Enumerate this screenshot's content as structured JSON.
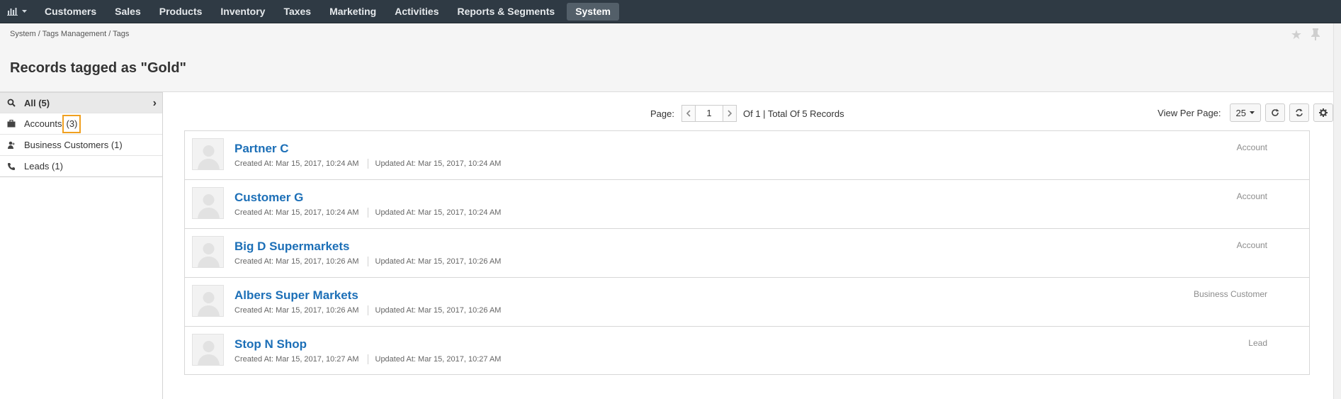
{
  "nav": {
    "items": [
      "Customers",
      "Sales",
      "Products",
      "Inventory",
      "Taxes",
      "Marketing",
      "Activities",
      "Reports & Segments"
    ],
    "active": "System",
    "logo_icon": "bar-chart-icon",
    "accent": "#2f3a44"
  },
  "header": {
    "breadcrumb": "System / Tags Management / Tags",
    "title": "Records tagged as \"Gold\"",
    "icons": [
      "star-icon",
      "pin-icon"
    ]
  },
  "sidebar": {
    "items": [
      {
        "label": "All (5)",
        "icon": "search-icon"
      },
      {
        "label": "Accounts",
        "count": "(3)",
        "icon": "briefcase-icon"
      },
      {
        "label": "Business Customers (1)",
        "icon": "user-group-icon"
      },
      {
        "label": "Leads (1)",
        "icon": "phone-icon"
      }
    ]
  },
  "pager": {
    "label": "Page:",
    "current": "1",
    "total_text": "Of 1 | Total Of 5 Records",
    "view_per_page_label": "View Per Page:",
    "per_page": "25"
  },
  "records": [
    {
      "title": "Partner C",
      "created": "Created At: Mar 15, 2017, 10:24 AM",
      "updated": "Updated At: Mar 15, 2017, 10:24 AM",
      "type": "Account"
    },
    {
      "title": "Customer G",
      "created": "Created At: Mar 15, 2017, 10:24 AM",
      "updated": "Updated At: Mar 15, 2017, 10:24 AM",
      "type": "Account"
    },
    {
      "title": "Big D Supermarkets",
      "created": "Created At: Mar 15, 2017, 10:26 AM",
      "updated": "Updated At: Mar 15, 2017, 10:26 AM",
      "type": "Account"
    },
    {
      "title": "Albers Super Markets",
      "created": "Created At: Mar 15, 2017, 10:26 AM",
      "updated": "Updated At: Mar 15, 2017, 10:26 AM",
      "type": "Business Customer"
    },
    {
      "title": "Stop N Shop",
      "created": "Created At: Mar 15, 2017, 10:27 AM",
      "updated": "Updated At: Mar 15, 2017, 10:27 AM",
      "type": "Lead"
    }
  ]
}
